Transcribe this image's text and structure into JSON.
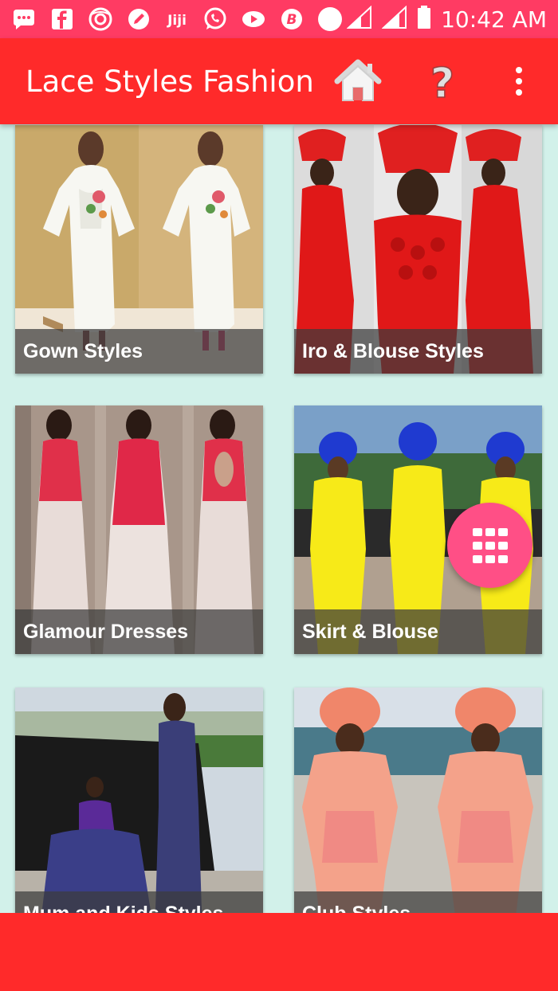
{
  "status_bar": {
    "time": "10:42 AM",
    "notification_icons": [
      "messenger-icon",
      "facebook-icon",
      "browser-icon",
      "edit-icon",
      "jiji-icon",
      "whatsapp-icon",
      "video-icon",
      "b-icon",
      "circle-icon"
    ],
    "jiji_text": "Jiji",
    "b_text": "B"
  },
  "app_bar": {
    "title": "Lace Styles Fashion",
    "help_symbol": "?"
  },
  "cards": [
    {
      "label": "Gown Styles"
    },
    {
      "label": "Iro & Blouse Styles"
    },
    {
      "label": "Glamour Dresses"
    },
    {
      "label": "Skirt & Blouse"
    },
    {
      "label": "Mum and Kids Styles"
    },
    {
      "label": "Club Styles"
    }
  ],
  "colors": {
    "status_bar": "#ff3b63",
    "app_bar": "#ff2a2a",
    "background": "#d2f1ea",
    "fab": "#ff4f86"
  }
}
